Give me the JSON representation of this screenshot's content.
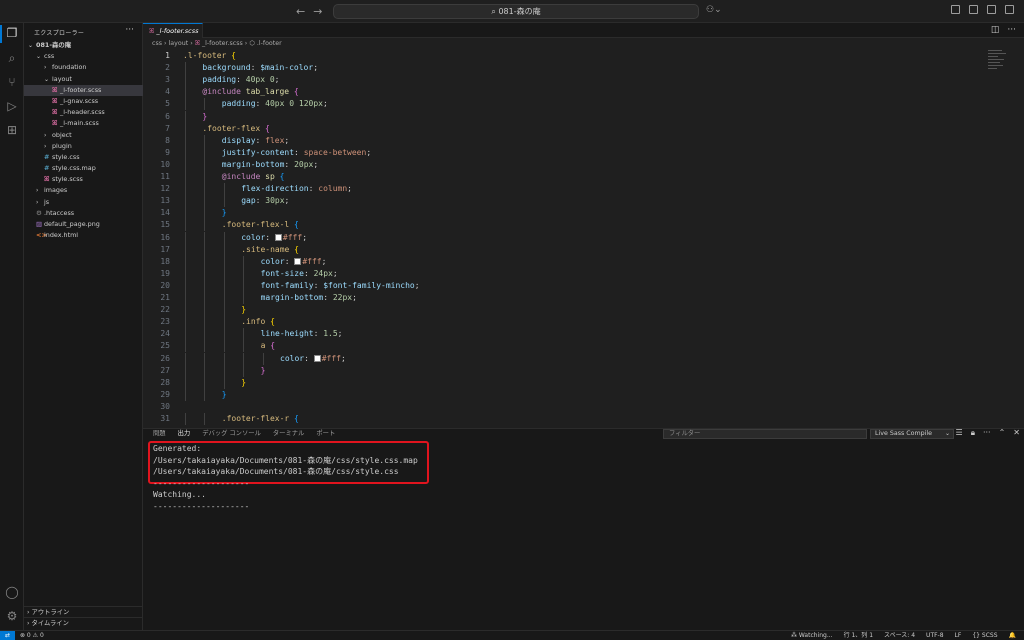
{
  "titlebar": {
    "search_text": "081-森の庵",
    "back_arrow": "←",
    "forward_arrow": "→"
  },
  "activity": {
    "explorer": "explorer-icon",
    "search": "search-icon",
    "scm": "source-control-icon",
    "debug": "run-debug-icon",
    "extensions": "extensions-icon",
    "account": "account-icon",
    "settings": "gear-icon"
  },
  "sidebar": {
    "title": "エクスプローラー",
    "more": "···",
    "tree": [
      {
        "label": "081-森の庵",
        "depth": 0,
        "type": "folder",
        "open": true,
        "bold": true
      },
      {
        "label": "css",
        "depth": 1,
        "type": "folder",
        "open": true
      },
      {
        "label": "foundation",
        "depth": 2,
        "type": "folder",
        "open": false
      },
      {
        "label": "layout",
        "depth": 2,
        "type": "folder",
        "open": true
      },
      {
        "label": "_l-footer.scss",
        "depth": 3,
        "type": "scss",
        "selected": true
      },
      {
        "label": "_l-gnav.scss",
        "depth": 3,
        "type": "scss"
      },
      {
        "label": "_l-header.scss",
        "depth": 3,
        "type": "scss"
      },
      {
        "label": "_l-main.scss",
        "depth": 3,
        "type": "scss"
      },
      {
        "label": "object",
        "depth": 2,
        "type": "folder",
        "open": false
      },
      {
        "label": "plugin",
        "depth": 2,
        "type": "folder",
        "open": false
      },
      {
        "label": "style.css",
        "depth": 2,
        "type": "css"
      },
      {
        "label": "style.css.map",
        "depth": 2,
        "type": "css"
      },
      {
        "label": "style.scss",
        "depth": 2,
        "type": "scss"
      },
      {
        "label": "images",
        "depth": 1,
        "type": "folder",
        "open": false
      },
      {
        "label": "js",
        "depth": 1,
        "type": "folder",
        "open": false
      },
      {
        "label": ".htaccess",
        "depth": 1,
        "type": "gear"
      },
      {
        "label": "default_page.png",
        "depth": 1,
        "type": "image"
      },
      {
        "label": "index.html",
        "depth": 1,
        "type": "html"
      }
    ],
    "outline": "アウトライン",
    "timeline": "タイムライン"
  },
  "editor": {
    "tab_label": "_l-footer.scss",
    "breadcrumb": [
      "css",
      "layout",
      "_l-footer.scss",
      ".l-footer"
    ],
    "current_line": 1,
    "lines": [
      {
        "n": "1",
        "i": 0,
        "t": [
          [
            ".l-footer ",
            "t-sel"
          ],
          [
            "{",
            "t-br1"
          ]
        ]
      },
      {
        "n": "2",
        "i": 1,
        "t": [
          [
            "background",
            "t-prop"
          ],
          [
            ": ",
            "t-pl"
          ],
          [
            "$main-color",
            "t-var"
          ],
          [
            ";",
            "t-pl"
          ]
        ]
      },
      {
        "n": "3",
        "i": 1,
        "t": [
          [
            "padding",
            "t-prop"
          ],
          [
            ": ",
            "t-pl"
          ],
          [
            "40px",
            "t-num"
          ],
          [
            " ",
            "t-pl"
          ],
          [
            "0",
            "t-num"
          ],
          [
            ";",
            "t-pl"
          ]
        ]
      },
      {
        "n": "4",
        "i": 1,
        "t": [
          [
            "@include ",
            "t-at"
          ],
          [
            "tab_large ",
            "t-fn"
          ],
          [
            "{",
            "t-br2"
          ]
        ]
      },
      {
        "n": "5",
        "i": 2,
        "t": [
          [
            "padding",
            "t-prop"
          ],
          [
            ": ",
            "t-pl"
          ],
          [
            "40px",
            "t-num"
          ],
          [
            " ",
            "t-pl"
          ],
          [
            "0",
            "t-num"
          ],
          [
            " ",
            "t-pl"
          ],
          [
            "120px",
            "t-num"
          ],
          [
            ";",
            "t-pl"
          ]
        ]
      },
      {
        "n": "6",
        "i": 1,
        "t": [
          [
            "}",
            "t-br2"
          ]
        ]
      },
      {
        "n": "7",
        "i": 1,
        "t": [
          [
            ".footer-flex ",
            "t-sel"
          ],
          [
            "{",
            "t-br2"
          ]
        ]
      },
      {
        "n": "8",
        "i": 2,
        "t": [
          [
            "display",
            "t-prop"
          ],
          [
            ": ",
            "t-pl"
          ],
          [
            "flex",
            "t-val"
          ],
          [
            ";",
            "t-pl"
          ]
        ]
      },
      {
        "n": "9",
        "i": 2,
        "t": [
          [
            "justify-content",
            "t-prop"
          ],
          [
            ": ",
            "t-pl"
          ],
          [
            "space-between",
            "t-val"
          ],
          [
            ";",
            "t-pl"
          ]
        ]
      },
      {
        "n": "10",
        "i": 2,
        "t": [
          [
            "margin-bottom",
            "t-prop"
          ],
          [
            ": ",
            "t-pl"
          ],
          [
            "20px",
            "t-num"
          ],
          [
            ";",
            "t-pl"
          ]
        ]
      },
      {
        "n": "11",
        "i": 2,
        "t": [
          [
            "@include ",
            "t-at"
          ],
          [
            "sp ",
            "t-fn"
          ],
          [
            "{",
            "t-br3"
          ]
        ]
      },
      {
        "n": "12",
        "i": 3,
        "t": [
          [
            "flex-direction",
            "t-prop"
          ],
          [
            ": ",
            "t-pl"
          ],
          [
            "column",
            "t-val"
          ],
          [
            ";",
            "t-pl"
          ]
        ]
      },
      {
        "n": "13",
        "i": 3,
        "t": [
          [
            "gap",
            "t-prop"
          ],
          [
            ": ",
            "t-pl"
          ],
          [
            "30px",
            "t-num"
          ],
          [
            ";",
            "t-pl"
          ]
        ]
      },
      {
        "n": "14",
        "i": 2,
        "t": [
          [
            "}",
            "t-br3"
          ]
        ]
      },
      {
        "n": "15",
        "i": 2,
        "t": [
          [
            ".footer-flex-l ",
            "t-sel"
          ],
          [
            "{",
            "t-br3"
          ]
        ]
      },
      {
        "n": "16",
        "i": 3,
        "t": [
          [
            "color",
            "t-prop"
          ],
          [
            ": ",
            "t-pl"
          ],
          [
            "#SW#",
            "sw"
          ],
          [
            "#fff",
            "t-val"
          ],
          [
            ";",
            "t-pl"
          ]
        ]
      },
      {
        "n": "17",
        "i": 3,
        "t": [
          [
            ".site-name ",
            "t-sel"
          ],
          [
            "{",
            "t-br1"
          ]
        ]
      },
      {
        "n": "18",
        "i": 4,
        "t": [
          [
            "color",
            "t-prop"
          ],
          [
            ": ",
            "t-pl"
          ],
          [
            "#SW#",
            "sw"
          ],
          [
            "#fff",
            "t-val"
          ],
          [
            ";",
            "t-pl"
          ]
        ]
      },
      {
        "n": "19",
        "i": 4,
        "t": [
          [
            "font-size",
            "t-prop"
          ],
          [
            ": ",
            "t-pl"
          ],
          [
            "24px",
            "t-num"
          ],
          [
            ";",
            "t-pl"
          ]
        ]
      },
      {
        "n": "20",
        "i": 4,
        "t": [
          [
            "font-family",
            "t-prop"
          ],
          [
            ": ",
            "t-pl"
          ],
          [
            "$font-family-mincho",
            "t-var"
          ],
          [
            ";",
            "t-pl"
          ]
        ]
      },
      {
        "n": "21",
        "i": 4,
        "t": [
          [
            "margin-bottom",
            "t-prop"
          ],
          [
            ": ",
            "t-pl"
          ],
          [
            "22px",
            "t-num"
          ],
          [
            ";",
            "t-pl"
          ]
        ]
      },
      {
        "n": "22",
        "i": 3,
        "t": [
          [
            "}",
            "t-br1"
          ]
        ]
      },
      {
        "n": "23",
        "i": 3,
        "t": [
          [
            ".info ",
            "t-sel"
          ],
          [
            "{",
            "t-br1"
          ]
        ]
      },
      {
        "n": "24",
        "i": 4,
        "t": [
          [
            "line-height",
            "t-prop"
          ],
          [
            ": ",
            "t-pl"
          ],
          [
            "1.5",
            "t-num"
          ],
          [
            ";",
            "t-pl"
          ]
        ]
      },
      {
        "n": "25",
        "i": 4,
        "t": [
          [
            "a ",
            "t-sel"
          ],
          [
            "{",
            "t-br2"
          ]
        ]
      },
      {
        "n": "26",
        "i": 5,
        "t": [
          [
            "color",
            "t-prop"
          ],
          [
            ": ",
            "t-pl"
          ],
          [
            "#SW#",
            "sw"
          ],
          [
            "#fff",
            "t-val"
          ],
          [
            ";",
            "t-pl"
          ]
        ]
      },
      {
        "n": "27",
        "i": 4,
        "t": [
          [
            "}",
            "t-br2"
          ]
        ]
      },
      {
        "n": "28",
        "i": 3,
        "t": [
          [
            "}",
            "t-br1"
          ]
        ]
      },
      {
        "n": "29",
        "i": 2,
        "t": [
          [
            "}",
            "t-br3"
          ]
        ]
      },
      {
        "n": "30",
        "i": 0,
        "t": []
      },
      {
        "n": "31",
        "i": 2,
        "t": [
          [
            ".footer-flex-r ",
            "t-sel"
          ],
          [
            "{",
            "t-br3"
          ]
        ]
      }
    ]
  },
  "panel": {
    "tabs": [
      "問題",
      "出力",
      "デバッグ コンソール",
      "ターミナル",
      "ポート"
    ],
    "filter_placeholder": "フィルター",
    "channel": "Live Sass Compile",
    "output": [
      {
        "text": "Generated:",
        "link": false
      },
      {
        "text": "/Users/takaiayaka/Documents/081-森の庵/css/style.css.map",
        "link": true
      },
      {
        "text": "/Users/takaiayaka/Documents/081-森の庵/css/style.css",
        "link": true
      },
      {
        "text": "--------------------",
        "link": false
      },
      {
        "text": "Watching...",
        "link": false
      },
      {
        "text": "--------------------",
        "link": false
      }
    ]
  },
  "statusbar": {
    "remote": "⇄",
    "problems": "⊗ 0 ⚠ 0",
    "watching": "Watching...",
    "position": "行 1、列 1",
    "spaces": "スペース: 4",
    "encoding": "UTF-8",
    "eol": "LF",
    "language": "{} SCSS",
    "notifications": "🔔"
  },
  "colors": {
    "accent": "#0078d4",
    "highlight_box": "#e0141e"
  }
}
